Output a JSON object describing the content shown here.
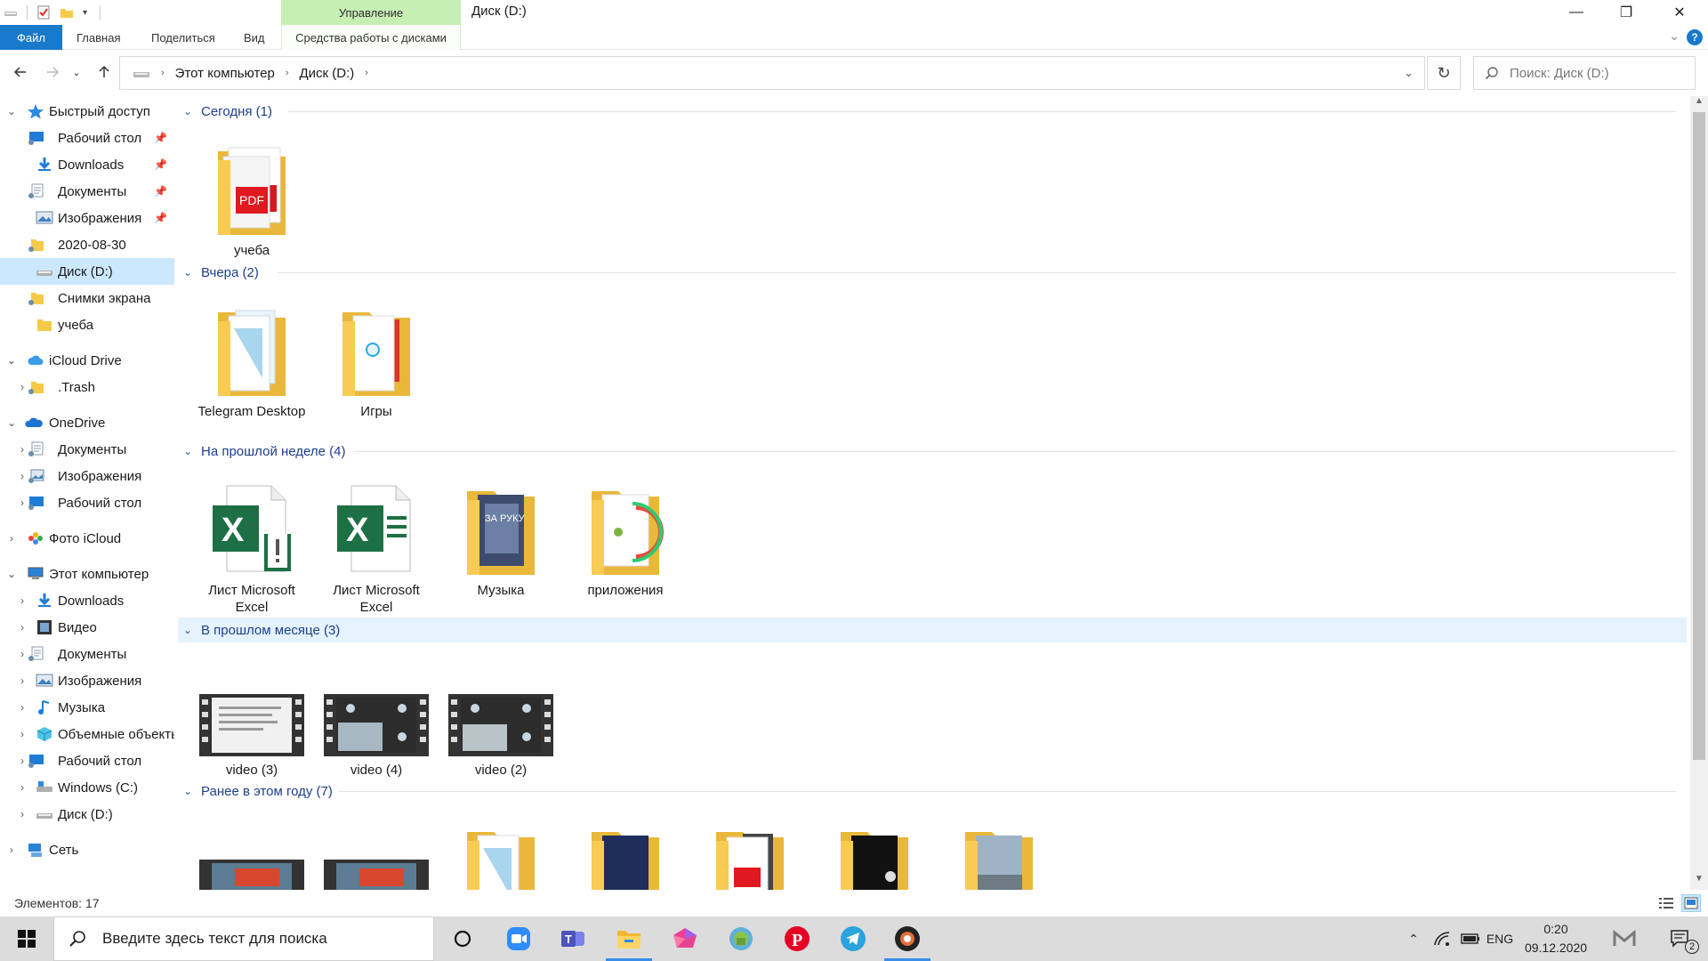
{
  "window": {
    "title": "Диск  (D:)",
    "context_band": "Управление",
    "minimize": "—",
    "maximize": "❐",
    "close": "✕"
  },
  "ribbon": {
    "tabs": [
      "Файл",
      "Главная",
      "Поделиться",
      "Вид",
      "Средства работы с дисками"
    ],
    "help": "?"
  },
  "address": {
    "crumbs": [
      "Этот компьютер",
      "Диск  (D:)"
    ],
    "search_placeholder": "Поиск: Диск  (D:)"
  },
  "nav": {
    "quick_access": "Быстрый доступ",
    "quick_items": [
      "Рабочий стол",
      "Downloads",
      "Документы",
      "Изображения",
      "2020-08-30",
      "Диск  (D:)",
      "Снимки экрана",
      "учеба"
    ],
    "icloud": "iCloud Drive",
    "icloud_items": [
      ".Trash"
    ],
    "onedrive": "OneDrive",
    "onedrive_items": [
      "Документы",
      "Изображения",
      "Рабочий стол"
    ],
    "photos_icloud": "Фото iCloud",
    "this_pc": "Этот компьютер",
    "pc_items": [
      "Downloads",
      "Видео",
      "Документы",
      "Изображения",
      "Музыка",
      "Объемные объекты",
      "Рабочий стол",
      "Windows (C:)",
      "Диск  (D:)"
    ],
    "network": "Сеть"
  },
  "groups": [
    {
      "title": "Сегодня (1)",
      "items": [
        "учеба"
      ]
    },
    {
      "title": "Вчера (2)",
      "items": [
        "Telegram Desktop",
        "Игры"
      ]
    },
    {
      "title": "На прошлой неделе (4)",
      "items": [
        "Лист Microsoft Excel",
        "Лист Microsoft Excel",
        "Музыка",
        "приложения"
      ]
    },
    {
      "title": "В прошлом месяце (3)",
      "items": [
        "video (3)",
        "video (4)",
        "video (2)"
      ]
    },
    {
      "title": "Ранее в этом году (7)",
      "items": []
    }
  ],
  "status": {
    "count": "Элементов: 17"
  },
  "taskbar": {
    "search_placeholder": "Введите здесь текст для поиска",
    "lang": "ENG",
    "time": "0:20",
    "date": "09.12.2020",
    "notif_count": "2"
  },
  "colors": {
    "accent": "#1979ca",
    "context": "#c6efb4",
    "selection": "#cce8ff",
    "group_title": "#1e3f8a"
  }
}
